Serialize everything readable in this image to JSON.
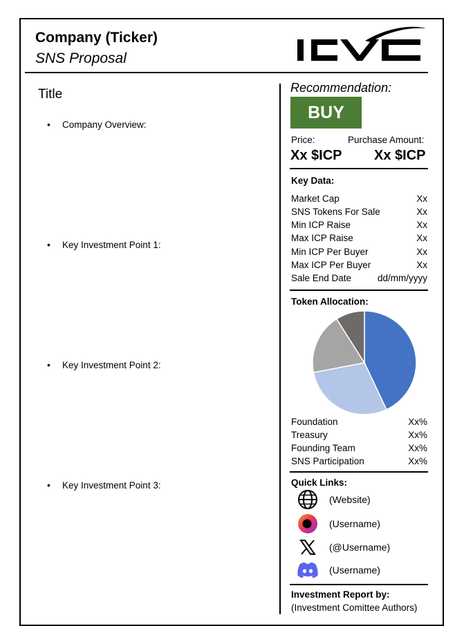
{
  "header": {
    "title": "Company (Ticker)",
    "subtitle": "SNS Proposal",
    "logo_text": "ICVC"
  },
  "left": {
    "title": "Title",
    "bullets": [
      "Company Overview:",
      "Key Investment Point 1:",
      "Key Investment Point 2:",
      "Key Investment Point 3:"
    ]
  },
  "recommendation": {
    "label": "Recommendation:",
    "value": "BUY",
    "color": "#4b7d35",
    "price_label": "Price:",
    "purchase_label": "Purchase Amount:",
    "price_value": "Xx $ICP",
    "purchase_value": "Xx $ICP"
  },
  "key_data": {
    "heading": "Key Data:",
    "rows": [
      {
        "label": "Market Cap",
        "value": "Xx"
      },
      {
        "label": "SNS Tokens For Sale",
        "value": "Xx"
      },
      {
        "label": "Min ICP Raise",
        "value": "Xx"
      },
      {
        "label": "Max ICP Raise",
        "value": "Xx"
      },
      {
        "label": "Min ICP Per Buyer",
        "value": "Xx"
      },
      {
        "label": "Max ICP Per Buyer",
        "value": "Xx"
      },
      {
        "label": "Sale End Date",
        "value": "dd/mm/yyyy"
      }
    ]
  },
  "token_allocation": {
    "heading": "Token Allocation:",
    "rows": [
      {
        "label": "Foundation",
        "value": "Xx%"
      },
      {
        "label": "Treasury",
        "value": "Xx%"
      },
      {
        "label": "Founding Team",
        "value": "Xx%"
      },
      {
        "label": "SNS Participation",
        "value": "Xx%"
      }
    ]
  },
  "chart_data": {
    "type": "pie",
    "categories": [
      "Foundation",
      "Treasury",
      "Founding Team",
      "SNS Participation"
    ],
    "values": [
      43,
      29,
      19,
      9
    ],
    "colors": [
      "#4472c4",
      "#b4c6e7",
      "#a5a5a5",
      "#6e6a68"
    ]
  },
  "quick_links": {
    "heading": "Quick Links:",
    "items": [
      {
        "icon": "globe-icon",
        "text": "(Website)"
      },
      {
        "icon": "openchat-icon",
        "text": "(Username)"
      },
      {
        "icon": "x-logo-icon",
        "text": "(@Username)"
      },
      {
        "icon": "discord-icon",
        "text": "(Username)"
      }
    ]
  },
  "footer": {
    "heading": "Investment Report by:",
    "authors": "(Investment Comittee Authors)"
  }
}
